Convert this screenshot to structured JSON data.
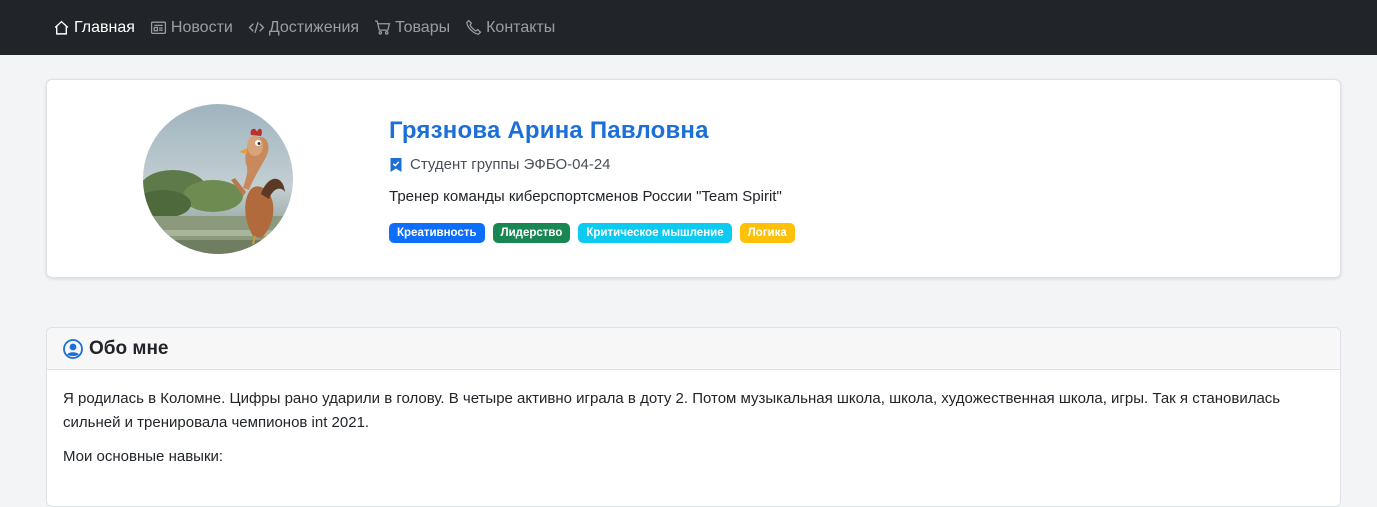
{
  "nav": {
    "items": [
      {
        "label": "Главная",
        "icon": "house-icon",
        "active": true
      },
      {
        "label": "Новости",
        "icon": "newspaper-icon",
        "active": false
      },
      {
        "label": "Достижения",
        "icon": "code-icon",
        "active": false
      },
      {
        "label": "Товары",
        "icon": "cart-icon",
        "active": false
      },
      {
        "label": "Контакты",
        "icon": "phone-icon",
        "active": false
      }
    ]
  },
  "profile": {
    "name": "Грязнова Арина Павловна",
    "group": "Студент группы ЭФБО-04-24",
    "role": "Тренер команды киберспортсменов России \"Team Spirit\"",
    "badges": [
      {
        "label": "Креативность",
        "color": "#0d6efd"
      },
      {
        "label": "Лидерство",
        "color": "#198754"
      },
      {
        "label": "Критическое мышление",
        "color": "#0dcaf0"
      },
      {
        "label": "Логика",
        "color": "#ffc107"
      }
    ]
  },
  "about": {
    "title": "Обо мне",
    "paragraph": "Я родилась в Коломне. Цифры рано ударили в голову. В четыре активно играла в доту 2. Потом музыкальная школа, школа, художественная школа, игры. Так я становилась сильней и тренировала чемпионов int 2021.",
    "skills_label": "Мои основные навыки:"
  },
  "colors": {
    "navbar_bg": "#212529",
    "accent": "#1b6fd6",
    "page_bg": "#f3f4f6"
  }
}
